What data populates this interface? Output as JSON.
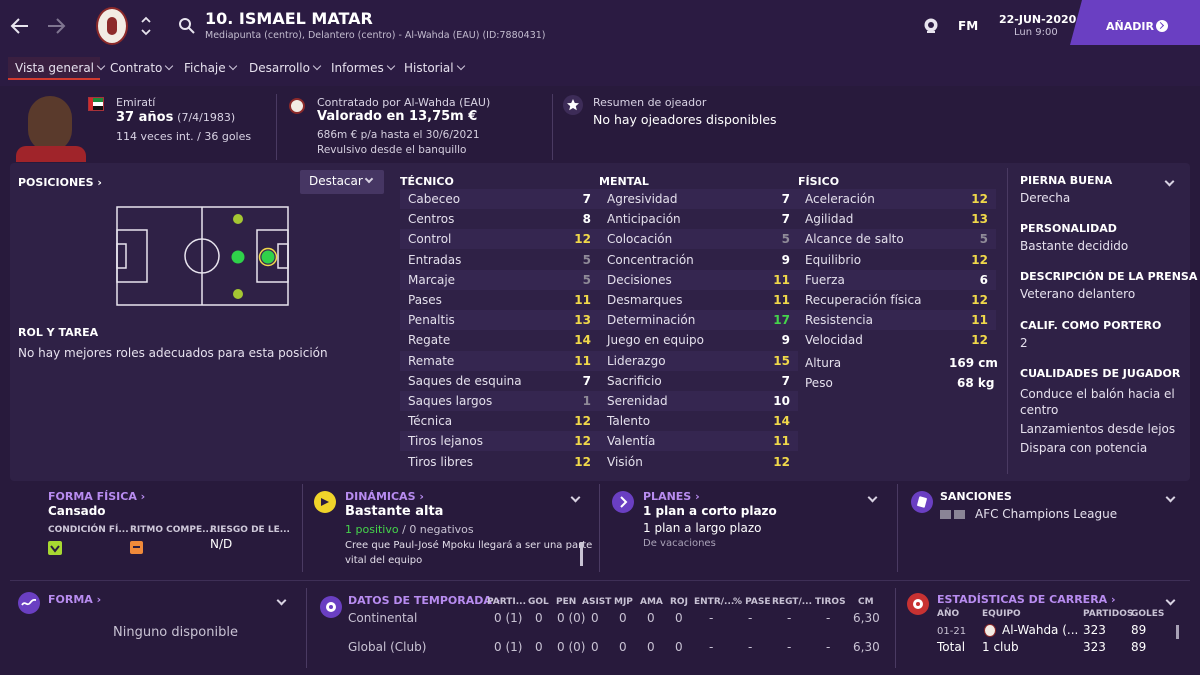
{
  "header": {
    "back_icon": "arrow-left-icon",
    "forward_icon": "arrow-right-icon",
    "player_title": "10. ISMAEL MATAR",
    "player_subtitle": "Mediapunta (centro), Delantero (centro) - Al-Wahda (EAU) (ID:7880431)",
    "fm_label": "FM",
    "date": "22-JUN-2020",
    "day": "Lun 9:00",
    "add_label": "AÑADIR",
    "accent": "#6a3fc2"
  },
  "nav": [
    "Vista general",
    "Contrato",
    "Fichaje",
    "Desarrollo",
    "Informes",
    "Historial"
  ],
  "summary": {
    "nationality": "Emiratí",
    "age": "37 años",
    "dob": "(7/4/1983)",
    "caps": "114 veces int. / 36 goles",
    "contract_label": "Contratado por Al-Wahda (EAU)",
    "value": "Valorado en 13,75m €",
    "wage": "686m € p/a hasta el 30/6/2021",
    "role": "Revulsivo desde el banquillo",
    "scout_label": "Resumen de ojeador",
    "scout_value": "No hay ojeadores disponibles"
  },
  "positions": {
    "label": "POSICIONES",
    "button": "Destacar",
    "role_label": "ROL Y TAREA",
    "role_value": "No hay mejores roles adecuados para esta posición"
  },
  "tecnico": {
    "title": "TÉCNICO",
    "items": [
      {
        "n": "Cabeceo",
        "v": "7",
        "c": "w"
      },
      {
        "n": "Centros",
        "v": "8",
        "c": "w"
      },
      {
        "n": "Control",
        "v": "12",
        "c": "y"
      },
      {
        "n": "Entradas",
        "v": "5",
        "c": "d"
      },
      {
        "n": "Marcaje",
        "v": "5",
        "c": "d"
      },
      {
        "n": "Pases",
        "v": "11",
        "c": "y"
      },
      {
        "n": "Penaltis",
        "v": "13",
        "c": "y"
      },
      {
        "n": "Regate",
        "v": "14",
        "c": "y"
      },
      {
        "n": "Remate",
        "v": "11",
        "c": "y"
      },
      {
        "n": "Saques de esquina",
        "v": "7",
        "c": "w"
      },
      {
        "n": "Saques largos",
        "v": "1",
        "c": "d"
      },
      {
        "n": "Técnica",
        "v": "12",
        "c": "y"
      },
      {
        "n": "Tiros lejanos",
        "v": "12",
        "c": "y"
      },
      {
        "n": "Tiros libres",
        "v": "12",
        "c": "y"
      }
    ]
  },
  "mental": {
    "title": "MENTAL",
    "items": [
      {
        "n": "Agresividad",
        "v": "7",
        "c": "w"
      },
      {
        "n": "Anticipación",
        "v": "7",
        "c": "w"
      },
      {
        "n": "Colocación",
        "v": "5",
        "c": "d"
      },
      {
        "n": "Concentración",
        "v": "9",
        "c": "w"
      },
      {
        "n": "Decisiones",
        "v": "11",
        "c": "y"
      },
      {
        "n": "Desmarques",
        "v": "11",
        "c": "y"
      },
      {
        "n": "Determinación",
        "v": "17",
        "c": "g"
      },
      {
        "n": "Juego en equipo",
        "v": "9",
        "c": "w"
      },
      {
        "n": "Liderazgo",
        "v": "15",
        "c": "y"
      },
      {
        "n": "Sacrificio",
        "v": "7",
        "c": "w"
      },
      {
        "n": "Serenidad",
        "v": "10",
        "c": "w"
      },
      {
        "n": "Talento",
        "v": "14",
        "c": "y"
      },
      {
        "n": "Valentía",
        "v": "11",
        "c": "y"
      },
      {
        "n": "Visión",
        "v": "12",
        "c": "y"
      }
    ]
  },
  "fisico": {
    "title": "FÍSICO",
    "items": [
      {
        "n": "Aceleración",
        "v": "12",
        "c": "y"
      },
      {
        "n": "Agilidad",
        "v": "13",
        "c": "y"
      },
      {
        "n": "Alcance de salto",
        "v": "5",
        "c": "d"
      },
      {
        "n": "Equilibrio",
        "v": "12",
        "c": "y"
      },
      {
        "n": "Fuerza",
        "v": "6",
        "c": "w"
      },
      {
        "n": "Recuperación física",
        "v": "12",
        "c": "y"
      },
      {
        "n": "Resistencia",
        "v": "11",
        "c": "y"
      },
      {
        "n": "Velocidad",
        "v": "12",
        "c": "y"
      }
    ],
    "height_label": "Altura",
    "height": "169 cm",
    "weight_label": "Peso",
    "weight": "68 kg"
  },
  "right": {
    "foot_label": "PIERNA BUENA",
    "foot": "Derecha",
    "personality_label": "PERSONALIDAD",
    "personality": "Bastante decidido",
    "press_label": "DESCRIPCIÓN DE LA PRENSA",
    "press": "Veterano delantero",
    "gk_label": "CALIF. COMO PORTERO",
    "gk": "2",
    "qual_label": "CUALIDADES DE JUGADOR",
    "qualities": [
      "Conduce el balón hacia el",
      "centro",
      "Lanzamientos desde lejos",
      "Dispara con potencia"
    ]
  },
  "fitness": {
    "title": "FORMA FÍSICA",
    "value": "Cansado",
    "col1": "CONDICIÓN FÍ...",
    "col2": "RITMO COMPE...",
    "col3": "RIESGO DE LE...",
    "col3_val": "N/D"
  },
  "dynamics": {
    "title": "DINÁMICAS",
    "value": "Bastante alta",
    "pos": "1 positivo",
    "sep": " / ",
    "neg": "0 negativos",
    "note1": "Cree que Paul-José Mpoku llegará a ser una parte",
    "note2": "vital del equipo"
  },
  "plans": {
    "title": "PLANES",
    "p1": "1 plan a corto plazo",
    "p2": "1 plan a largo plazo",
    "p3": "De vacaciones"
  },
  "sanctions": {
    "title": "SANCIONES",
    "comp": "AFC Champions League"
  },
  "form": {
    "title": "FORMA",
    "value": "Ninguno disponible"
  },
  "season": {
    "title": "DATOS DE TEMPORADA",
    "cols": [
      "PARTI...",
      "GOL",
      "PEN",
      "ASIST",
      "MJP",
      "AMA",
      "ROJ",
      "ENTR/...",
      "% PASE",
      "REGT/...",
      "TIROS",
      "CM"
    ],
    "rows": [
      {
        "name": "Continental",
        "vals": [
          "0 (1)",
          "0",
          "0 (0)",
          "0",
          "0",
          "0",
          "0",
          "-",
          "-",
          "-",
          "-",
          "6,30"
        ]
      },
      {
        "name": "Global (Club)",
        "vals": [
          "0 (1)",
          "0",
          "0 (0)",
          "0",
          "0",
          "0",
          "0",
          "-",
          "-",
          "-",
          "-",
          "6,30"
        ]
      }
    ]
  },
  "career": {
    "title": "ESTADÍSTICAS DE CARRERA",
    "cols": [
      "AÑO",
      "EQUIPO",
      "PARTIDOS",
      "GOLES"
    ],
    "rows": [
      {
        "year": "01-21",
        "team": "Al-Wahda (...",
        "apps": "323",
        "goals": "89"
      },
      {
        "year": "Total",
        "team": "1 club",
        "apps": "323",
        "goals": "89"
      }
    ]
  }
}
